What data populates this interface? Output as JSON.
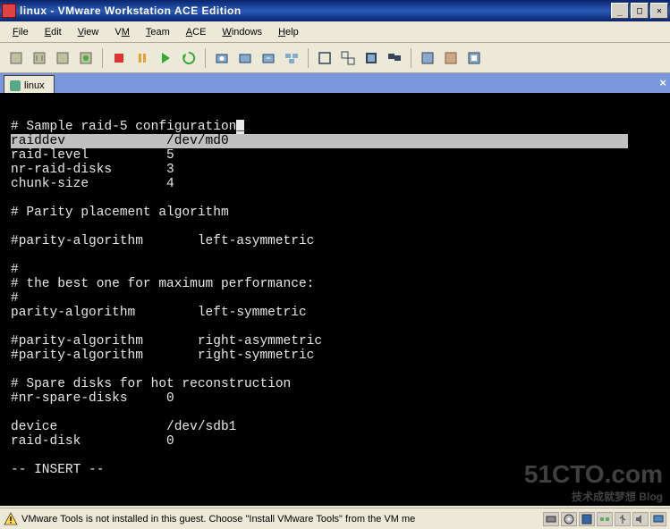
{
  "window": {
    "title": "linux - VMware Workstation ACE Edition"
  },
  "menu": {
    "items": [
      {
        "ul": "F",
        "rest": "ile"
      },
      {
        "ul": "E",
        "rest": "dit"
      },
      {
        "ul": "V",
        "rest": "iew"
      },
      {
        "ul": "",
        "rest": "VM",
        "ul2": "M",
        "pre": "V"
      },
      {
        "ul": "T",
        "rest": "eam"
      },
      {
        "ul": "A",
        "rest": "CE"
      },
      {
        "ul": "W",
        "rest": "indows"
      },
      {
        "ul": "H",
        "rest": "elp"
      }
    ]
  },
  "tab": {
    "label": "linux"
  },
  "terminal": {
    "lines": [
      {
        "t": "# Sample raid-5 configuration_",
        "hl": false,
        "cursor": true
      },
      {
        "t": "raiddev             /dev/md0",
        "hl": true
      },
      {
        "t": "raid-level          5",
        "hl": false
      },
      {
        "t": "nr-raid-disks       3",
        "hl": false
      },
      {
        "t": "chunk-size          4",
        "hl": false
      },
      {
        "t": "",
        "hl": false
      },
      {
        "t": "# Parity placement algorithm",
        "hl": false
      },
      {
        "t": "",
        "hl": false
      },
      {
        "t": "#parity-algorithm       left-asymmetric",
        "hl": false
      },
      {
        "t": "",
        "hl": false
      },
      {
        "t": "#",
        "hl": false
      },
      {
        "t": "# the best one for maximum performance:",
        "hl": false
      },
      {
        "t": "#",
        "hl": false
      },
      {
        "t": "parity-algorithm        left-symmetric",
        "hl": false
      },
      {
        "t": "",
        "hl": false
      },
      {
        "t": "#parity-algorithm       right-asymmetric",
        "hl": false
      },
      {
        "t": "#parity-algorithm       right-symmetric",
        "hl": false
      },
      {
        "t": "",
        "hl": false
      },
      {
        "t": "# Spare disks for hot reconstruction",
        "hl": false
      },
      {
        "t": "#nr-spare-disks     0",
        "hl": false
      },
      {
        "t": "",
        "hl": false
      },
      {
        "t": "device              /dev/sdb1",
        "hl": false
      },
      {
        "t": "raid-disk           0",
        "hl": false
      },
      {
        "t": "",
        "hl": false
      },
      {
        "t": "-- INSERT --",
        "hl": false
      }
    ]
  },
  "status": {
    "message": "VMware Tools is not installed in this guest. Choose \"Install VMware Tools\" from the VM me"
  },
  "watermark": {
    "main": "51CTO.com",
    "sub": "技术成就梦想  Blog"
  },
  "toolbar_icons": [
    "power-off-icon",
    "suspend-icon",
    "reset-icon",
    "poweron-icon",
    "sep",
    "stop-icon",
    "pause-icon",
    "play-icon",
    "recycle-icon",
    "sep",
    "snapshot-icon",
    "manage-snapshot-icon",
    "revert-icon",
    "snapshot-mgr-icon",
    "sep",
    "fullscreen-icon",
    "unity-icon",
    "console-icon",
    "multimon-icon",
    "sep",
    "summary-icon",
    "appliance-icon",
    "quickswitch-icon"
  ]
}
